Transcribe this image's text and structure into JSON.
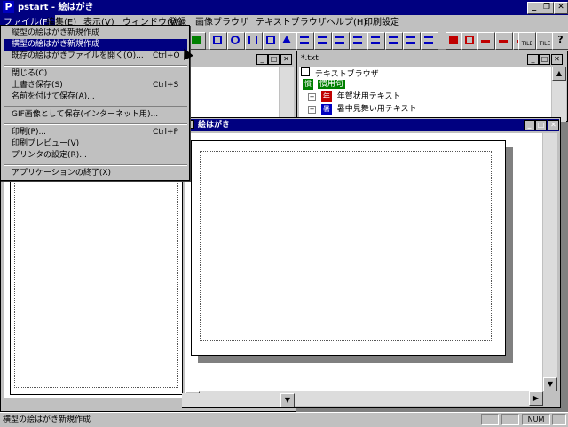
{
  "app": {
    "title": "pstart - 絵はがき",
    "icon_letter": "P",
    "caption_buttons": [
      "_",
      "❐",
      "✕"
    ]
  },
  "menubar": {
    "items": [
      "ファイル(F)",
      "編集(E)",
      "表示(V)",
      "ウィンドウ(W)",
      "登録",
      "画像ブラウザ",
      "テキストブラウザ",
      "ヘルプ(H)",
      "印刷設定"
    ]
  },
  "toolbar": {
    "icons": [
      "picture-icon",
      "frame-icon",
      "arrow-icon",
      "expand-icon",
      "fit-icon",
      "triangle-icon",
      "layout1-icon",
      "layout2-icon",
      "layout3-icon",
      "layout4-icon",
      "layout5-icon",
      "layout6-icon",
      "layout7-icon",
      "layout8-icon",
      "house-icon",
      "card-icon",
      "tile1-icon",
      "tile2-icon",
      "tile3-icon",
      "v-tile-icon",
      "h-tile-icon",
      "help-icon"
    ],
    "labels": {
      "v_tile": "TILE",
      "h_tile": "TILE",
      "help": "?"
    }
  },
  "file_menu": {
    "items": [
      {
        "label": "縦型の絵はがき新規作成",
        "shortcut": ""
      },
      {
        "label": "横型の絵はがき新規作成",
        "shortcut": ""
      },
      {
        "label": "既存の絵はがきファイルを開く(O)...",
        "shortcut": "Ctrl+O"
      },
      {
        "label": "閉じる(C)",
        "shortcut": ""
      },
      {
        "label": "上書き保存(S)",
        "shortcut": "Ctrl+S"
      },
      {
        "label": "名前を付けて保存(A)...",
        "shortcut": ""
      },
      {
        "label": "GIF画像として保存(インターネット用)...",
        "shortcut": ""
      },
      {
        "label": "印刷(P)...",
        "shortcut": "Ctrl+P"
      },
      {
        "label": "印刷プレビュー(V)",
        "shortcut": ""
      },
      {
        "label": "プリンタの設定(R)...",
        "shortcut": ""
      },
      {
        "label": "アプリケーションの終了(X)",
        "shortcut": ""
      }
    ],
    "highlighted_index": 1
  },
  "text_browser": {
    "title": "*.txt",
    "root": "テキストブラウザ",
    "folder": "慣用句",
    "children": [
      "年賀状用テキスト",
      "暑中見舞い用テキスト"
    ],
    "folder_icon_char": "慣",
    "child_icon_chars": [
      "年",
      "暑"
    ],
    "expand_symbol": "+"
  },
  "postcard_window": {
    "title": "絵はがき"
  },
  "statusbar": {
    "message": "横型の絵はがき新規作成",
    "num": "NUM"
  },
  "colors": {
    "titlebar": "#000080",
    "face": "#c0c0c0",
    "highlight": "#000080"
  }
}
